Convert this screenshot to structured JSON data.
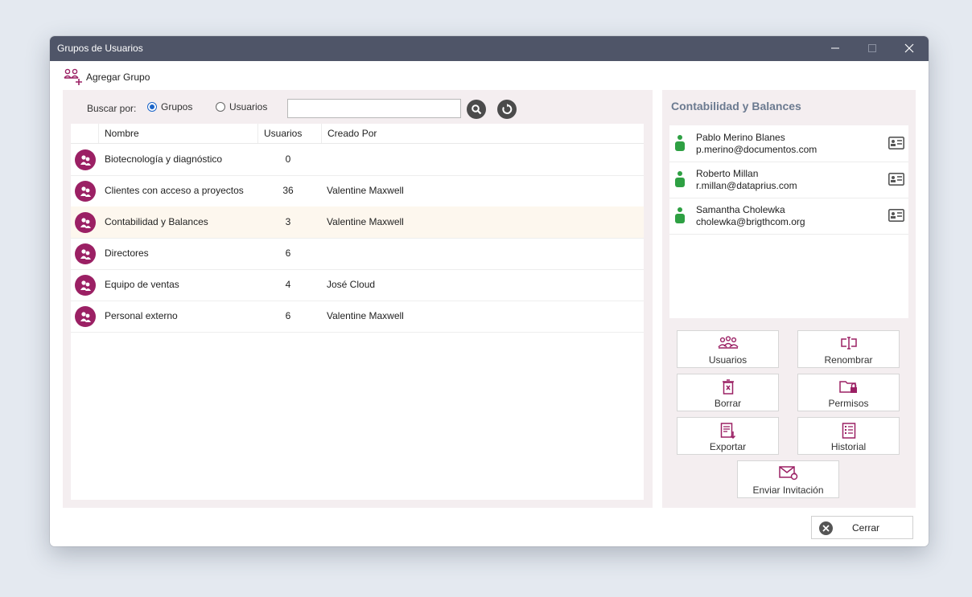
{
  "window": {
    "title": "Grupos de Usuarios"
  },
  "toolbar": {
    "add_group_label": "Agregar Grupo"
  },
  "search": {
    "label": "Buscar por:",
    "options": [
      "Grupos",
      "Usuarios"
    ],
    "selected": "Grupos",
    "value": ""
  },
  "grid": {
    "columns": [
      "Nombre",
      "Usuarios",
      "Creado Por"
    ],
    "rows": [
      {
        "name": "Biotecnología y diagnóstico",
        "users": "0",
        "created_by": ""
      },
      {
        "name": "Clientes con acceso a proyectos",
        "users": "36",
        "created_by": "Valentine Maxwell"
      },
      {
        "name": "Contabilidad y Balances",
        "users": "3",
        "created_by": "Valentine Maxwell"
      },
      {
        "name": "Directores",
        "users": "6",
        "created_by": ""
      },
      {
        "name": "Equipo de ventas",
        "users": "4",
        "created_by": "José Cloud"
      },
      {
        "name": "Personal externo",
        "users": "6",
        "created_by": "Valentine Maxwell"
      }
    ],
    "selected_row": "Contabilidad y Balances"
  },
  "detail": {
    "title": "Contabilidad y Balances",
    "members": [
      {
        "name": "Pablo Merino Blanes",
        "email": "p.merino@documentos.com"
      },
      {
        "name": "Roberto Millan",
        "email": "r.millan@dataprius.com"
      },
      {
        "name": "Samantha Cholewka",
        "email": "cholewka@brigthcom.org"
      }
    ],
    "actions": {
      "users": "Usuarios",
      "rename": "Renombrar",
      "delete": "Borrar",
      "permissions": "Permisos",
      "export": "Exportar",
      "history": "Historial",
      "invite": "Enviar Invitación"
    }
  },
  "footer": {
    "close_label": "Cerrar"
  },
  "colors": {
    "titlebar": "#4f5568",
    "accent": "#9b2064",
    "panel": "#f4eef0",
    "selected_row": "#fdf7ee",
    "user_online": "#2ea043",
    "radio": "#1a64c8"
  }
}
